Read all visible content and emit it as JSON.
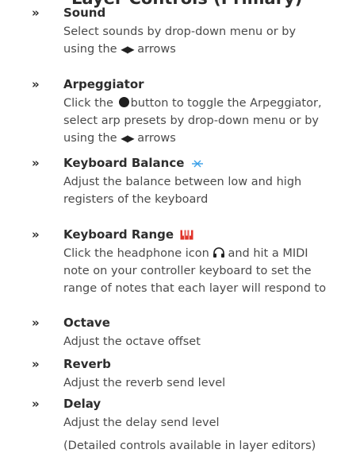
{
  "header": {
    "partial_title": "Layer Controls (Primary)"
  },
  "items": [
    {
      "bullet": "»",
      "title": "Sound",
      "desc_parts": [
        "Select sounds by drop-down menu or by using the ",
        "◀▶",
        " arrows"
      ]
    },
    {
      "bullet": "»",
      "title": "Arpeggiator",
      "desc_parts": [
        "Click the ",
        "button to toggle the Arpeggiator, select arp presets by drop-down menu or by using the ",
        "◀▶",
        " arrows"
      ]
    },
    {
      "bullet": "»",
      "title": "Keyboard Balance",
      "desc": "Adjust the balance between low and high registers of the keyboard"
    },
    {
      "bullet": "»",
      "title": "Keyboard Range",
      "desc_parts": [
        "Click the headphone icon ",
        "and hit a MIDI note on your controller keyboard to set the range of notes that each layer will respond to"
      ]
    },
    {
      "bullet": "»",
      "title": "Octave",
      "desc": "Adjust the octave offset"
    },
    {
      "bullet": "»",
      "title": "Reverb",
      "desc": "Adjust the reverb send level"
    },
    {
      "bullet": "»",
      "title": "Delay",
      "desc": "Adjust the delay send level"
    }
  ],
  "note": "(Detailed controls available in layer editors)",
  "icons": {
    "balance": "balance-icon",
    "keyboard_range": "piano-keys-icon",
    "headphone": "headphone-icon",
    "record_button": "circle-button-icon",
    "arrows": "left-right-arrows-icon"
  },
  "colors": {
    "balance_icon": "#3aa0e8",
    "keyboard_range_icon": "#e0342b",
    "text": "#4a4a4a",
    "title": "#2d2d2d"
  }
}
